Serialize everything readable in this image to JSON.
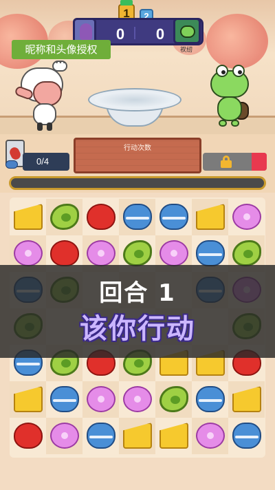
{
  "header": {
    "round_badge_left": "1",
    "round_badge_right": "2",
    "score_left": "0",
    "score_right": "0",
    "opponent_name": "衩纫",
    "auth_button_label": "昵称和头像授权"
  },
  "status": {
    "moves_count": "0/4",
    "action_panel_label": "行动次数"
  },
  "overlay": {
    "round_text": "回合 1",
    "action_text": "该你行动"
  },
  "colors": {
    "accent_green": "#6fae3a",
    "scoreboard": "#3f3a80",
    "overlay_purple": "#cbb6ff"
  },
  "board": {
    "rows": [
      [
        "cheese",
        "avocado",
        "heart",
        "macaron",
        "macaron",
        "cheese",
        "donut"
      ],
      [
        "donut",
        "heart",
        "donut",
        "avocado",
        "donut",
        "macaron",
        "avocado"
      ],
      [
        "macaron",
        "avocado",
        "",
        "",
        "",
        "macaron",
        "donut"
      ],
      [
        "avocado",
        "",
        "",
        "",
        "",
        "",
        "avocado"
      ],
      [
        "macaron",
        "avocado",
        "heart",
        "avocado",
        "cheese",
        "cheese",
        "heart"
      ],
      [
        "cheese",
        "macaron",
        "donut",
        "donut",
        "avocado",
        "macaron",
        "cheese"
      ],
      [
        "heart",
        "donut",
        "macaron",
        "cheese",
        "cheese",
        "donut",
        "macaron"
      ]
    ]
  }
}
